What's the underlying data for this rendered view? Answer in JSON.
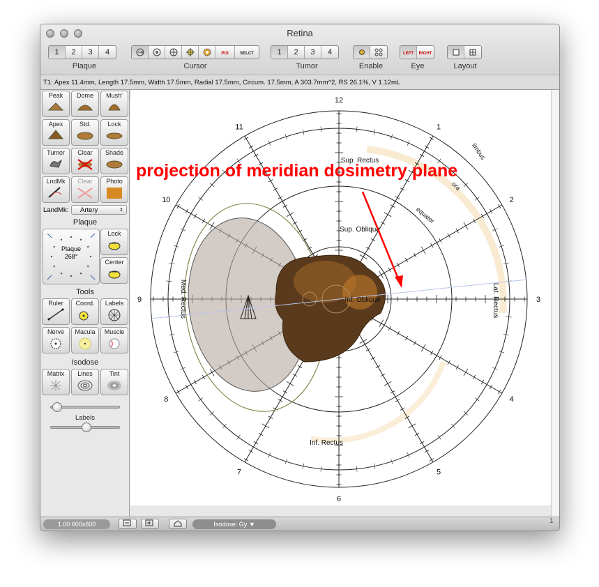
{
  "window": {
    "title": "Retina"
  },
  "toolbar": {
    "plaque": {
      "segments": [
        "1",
        "2",
        "3",
        "4"
      ],
      "selected": 0,
      "label": "Plaque"
    },
    "cursor": {
      "label": "Cursor",
      "icons": [
        "cursor-move-icon",
        "cursor-rotate-icon",
        "cursor-target-icon",
        "cursor-crosshair-icon",
        "cursor-gear-icon"
      ],
      "poi_label": "POI",
      "select_label": "SELCT"
    },
    "tumor": {
      "segments": [
        "1",
        "2",
        "3",
        "4"
      ],
      "selected": 0,
      "label": "Tumor"
    },
    "enable": {
      "label": "Enable"
    },
    "eye": {
      "label": "Eye",
      "left": "LEFT",
      "right": "RIGHT"
    },
    "layout": {
      "label": "Layout"
    }
  },
  "info": {
    "text": "T1: Apex 11.4mm, Length 17.5mm, Width 17.5mm, Radial 17.5mm, Circum. 17.5mm, A 303.7mm^2, RS 26.1%, V 1.12mL"
  },
  "sidebar": {
    "tumor_tools": [
      {
        "label": "Peak"
      },
      {
        "label": "Dome"
      },
      {
        "label": "Mush'"
      },
      {
        "label": "Apex"
      },
      {
        "label": "Std."
      },
      {
        "label": "Lock"
      },
      {
        "label": "Tumor"
      },
      {
        "label": "Clear"
      },
      {
        "label": "Shade"
      },
      {
        "label": "LndMk"
      },
      {
        "label": "Clear"
      },
      {
        "label": "Photo"
      }
    ],
    "landmark_label": "LandMk:",
    "landmark_value": "Artery",
    "plaque_header": "Plaque",
    "plaque_name": "Plaque",
    "plaque_angle": "268°",
    "plaque_lock": "Lock",
    "plaque_center": "Center",
    "tools_header": "Tools",
    "tools": [
      {
        "label": "Ruler"
      },
      {
        "label": "Coord."
      },
      {
        "label": "Labels"
      },
      {
        "label": "Nerve"
      },
      {
        "label": "Macula"
      },
      {
        "label": "Muscle"
      }
    ],
    "isodose_header": "Isodose",
    "isodose": [
      {
        "label": "Matrix"
      },
      {
        "label": "Lines"
      },
      {
        "label": "Tint"
      }
    ],
    "labels_slider_label": "Labels"
  },
  "diagram": {
    "clock_numbers": [
      "12",
      "1",
      "2",
      "3",
      "4",
      "5",
      "6",
      "7",
      "8",
      "9",
      "10",
      "11"
    ],
    "muscles": {
      "sup_rectus": "Sup. Rectus",
      "sup_oblique": "Sup. Oblique",
      "inf_oblique": "Inf. Oblique",
      "inf_rectus": "Inf. Rectus",
      "lat_rectus": "Lat. Rectus",
      "med_rectus": "Med. Rectus"
    },
    "rings": {
      "limbus": "limbus",
      "ora": "ora",
      "equator": "equator"
    },
    "annotation": "projection of meridian dosimetry plane",
    "annotation_color": "#ff0000"
  },
  "status": {
    "zoom": "1.00 600x600",
    "isodose_popup": "Isodose: Gy",
    "page": "1"
  }
}
